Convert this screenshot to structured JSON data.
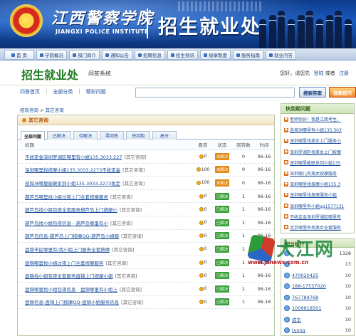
{
  "banner": {
    "logo_cn": "江西警察学院",
    "logo_en": "JIANGXI POLICE INSTITUTE",
    "title": "招生就业处"
  },
  "nav": [
    "首 页",
    "学院概况",
    "部门简介",
    "通知公告",
    "招聘信息",
    "招生快讯",
    "规章制度",
    "服务指南",
    "就业问答"
  ],
  "sub": {
    "title": "招生就业处",
    "tag": "问答系统",
    "greeting": "您好，请您先",
    "login": "登陆",
    "or": "或者",
    "register": "注册"
  },
  "search": {
    "tabs": [
      "问答首页",
      "全部分类",
      "精彩问题"
    ],
    "placeholder": "",
    "search_btn": "搜索答案",
    "ask_btn": "我要提问"
  },
  "crumb": {
    "root": "招就咨询",
    "sep": " > ",
    "current": "其它咨询"
  },
  "panel": {
    "header": "其它咨询",
    "tabs": [
      "全部问题",
      "已解决",
      "待解决",
      "零回答",
      "快到期",
      "高分"
    ],
    "columns": {
      "title": "标题",
      "bounty": "悬赏",
      "status": "状态",
      "answers": "回答数",
      "time": "时间"
    },
    "rows": [
      {
        "title": "不收定金深圳罗湖区哪里有小姐135.3033.227",
        "cat": "[其它咨询]",
        "bounty": "0",
        "status": "未解决",
        "answers": "0",
        "time": "06-16"
      },
      {
        "title": "深圳哪里找按摩小姐135.3033.2273不收定金",
        "cat": "[其它咨询]",
        "bounty": "100",
        "status": "未解决",
        "answers": "0",
        "time": "06-16"
      },
      {
        "title": "巡探洲哪里能联系到小姐135.3033.2273免定",
        "cat": "[其它咨询]",
        "bounty": "100",
        "status": "未解决",
        "answers": "0",
        "time": "06-16"
      },
      {
        "title": "葫芦岛哪里找小姐过夜上门全套按摩服务",
        "cat": "[其它咨询]",
        "bounty": "0",
        "status": "已解决",
        "answers": "1",
        "time": "06-16"
      },
      {
        "title": "葫芦岛找小姐包夜全套服务葫芦岛上门按摩小",
        "cat": "[其它咨询]",
        "bounty": "0",
        "status": "已解决",
        "answers": "1",
        "time": "06-16"
      },
      {
        "title": "葫芦岛找小姐包夜信息 - 葫芦岛哪里有小",
        "cat": "[其它咨询]",
        "bounty": "0",
        "status": "已解决",
        "answers": "1",
        "time": "06-16"
      },
      {
        "title": "葫芦岛信息-葫芦岛上门按摩QQ-葫芦岛小姐服",
        "cat": "[其它咨询]",
        "bounty": "0",
        "status": "已解决",
        "answers": "1",
        "time": "06-16"
      },
      {
        "title": "盘锦市区哪里有/找小姐上门服务全套按摩",
        "cat": "[其它咨询]",
        "bounty": "0",
        "status": "已解决",
        "answers": "1",
        "time": "06-16"
      },
      {
        "title": "盘锦哪里找小姐过夜上门全套按摩服务",
        "cat": "[其它咨询]",
        "bounty": "0",
        "status": "已解决",
        "answers": "1",
        "time": "06-16"
      },
      {
        "title": "盘锦找小姐包夜全套服务盘锦上门按摩小姐",
        "cat": "[其它咨询]",
        "bounty": "0",
        "status": "已解决",
        "answers": "1",
        "time": "06-16"
      },
      {
        "title": "盘锦哪里找小姐包夜信息 - 盘锦哪里有小姐上",
        "cat": "[其它咨询]",
        "bounty": "0",
        "status": "已解决",
        "answers": "1",
        "time": "06-16"
      },
      {
        "title": "盘锦信息-盘锦上门按摩QQ-盘锦小姐服务信息",
        "cat": "[其它咨询]",
        "bounty": "0",
        "status": "已解决",
        "answers": "1",
        "time": "06-16"
      }
    ]
  },
  "side": {
    "fast_title": "快到期问题",
    "fast_items": [
      "老师你好！我是江西考生，",
      "巡探洲哪里有小姐135.303",
      "深圳哪里找美女上门服务小",
      "深圳罗湖区找美女上门按摩",
      "深圳哪里能联系到小姐135",
      "深圳哪儿有美女按摩服务",
      "深圳哪里找按摩小姐135.3",
      "深圳哪里找按摩服务小姐",
      "深圳哪里有小姐qq1577131",
      "不收定金深圳罗湖区哪里有",
      "北京哪里有找美女全套服务"
    ],
    "rank_title": "积分排行",
    "rank_items": [
      {
        "name": "",
        "score": "1328"
      },
      {
        "name": "",
        "score": "13"
      },
      {
        "name": "470020425",
        "score": "10"
      },
      {
        "name": "188-17537020",
        "score": "10"
      },
      {
        "name": "767789768",
        "score": "10"
      },
      {
        "name": "1009618501",
        "score": "10"
      },
      {
        "name": "成丰",
        "score": "10"
      },
      {
        "name": "tyong",
        "score": "10"
      }
    ]
  },
  "watermark": {
    "cn": "大江网",
    "url": "www.jxnews.com.cn"
  }
}
